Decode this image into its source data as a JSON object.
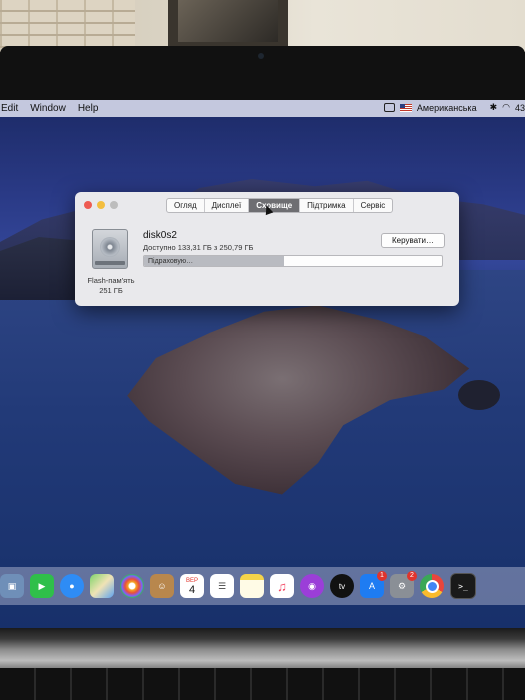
{
  "menubar": {
    "items": [
      "Edit",
      "Window",
      "Help"
    ],
    "input_source": "Американська",
    "battery": "43"
  },
  "dialog": {
    "tabs": [
      {
        "label": "Огляд",
        "active": false
      },
      {
        "label": "Дисплеї",
        "active": false
      },
      {
        "label": "Сховище",
        "active": true
      },
      {
        "label": "Підтримка",
        "active": false
      },
      {
        "label": "Сервіс",
        "active": false
      }
    ],
    "disk_name": "disk0s2",
    "available_text": "Доступно 133,31 ГБ з 250,79 ГБ",
    "manage_button": "Керувати…",
    "progress_label": "Підраховую…",
    "progress_fraction": 0.47,
    "disk_caption_line1": "Flash-пам'ять",
    "disk_caption_line2": "251 ГБ"
  },
  "dock": {
    "calendar_month": "ВЕР",
    "calendar_day": "4",
    "app_store_badge": "1",
    "system_prefs_badge": "2",
    "icons": [
      "preview-icon",
      "facetime-icon",
      "messages-icon",
      "maps-icon",
      "photos-icon",
      "contacts-icon",
      "calendar-icon",
      "reminders-icon",
      "notes-icon",
      "music-icon",
      "podcasts-icon",
      "apple-tv-icon",
      "app-store-icon",
      "system-preferences-icon",
      "chrome-icon",
      "terminal-icon"
    ],
    "colors": {
      "facetime": "#2fbf4a",
      "messages": "#2e8cf5",
      "music": "#f3425f",
      "podcasts": "#9b3ed8",
      "apple_tv": "#111111",
      "app_store": "#1e7cf2",
      "chrome": "#e9e9e9",
      "terminal": "#1a1a1a"
    }
  }
}
